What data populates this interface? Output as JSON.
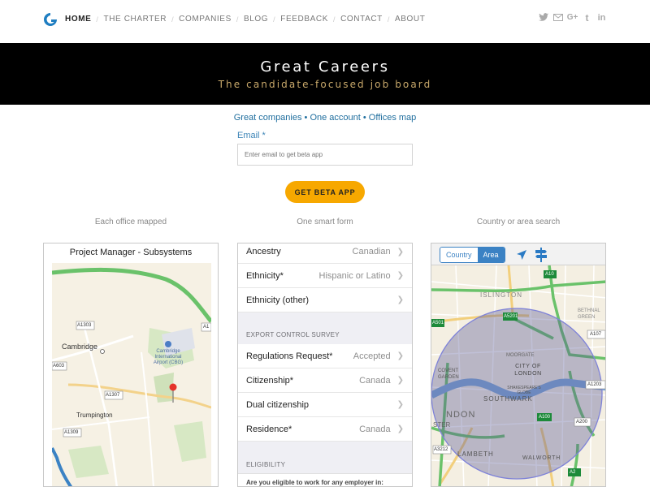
{
  "nav": {
    "items": [
      "HOME",
      "THE CHARTER",
      "COMPANIES",
      "BLOG",
      "FEEDBACK",
      "CONTACT",
      "ABOUT"
    ],
    "active": "HOME",
    "social_icons": [
      "twitter-icon",
      "mail-icon",
      "google-plus-icon",
      "tumblr-icon",
      "linkedin-icon"
    ]
  },
  "hero": {
    "title": "Great Careers",
    "subtitle": "The candidate-focused job board"
  },
  "signup": {
    "tagline": "Great companies • One account • Offices map",
    "email_label": "Email *",
    "email_placeholder": "Enter email to get beta app",
    "button_label": "GET BETA APP"
  },
  "features": [
    {
      "label": "Each office mapped"
    },
    {
      "label": "One smart form"
    },
    {
      "label": "Country or area search"
    }
  ],
  "panel_map": {
    "title": "Project Manager - Subsystems",
    "labels": {
      "cambridge": "Cambridge",
      "airport": "Cambridge International Airport (CBG)",
      "trumpington": "Trumpington",
      "roads": [
        "A1303",
        "A603",
        "A1307",
        "A1309",
        "A1"
      ]
    }
  },
  "panel_form": {
    "rows_top": [
      {
        "label": "Ancestry",
        "value": "Canadian"
      },
      {
        "label": "Ethnicity*",
        "value": "Hispanic or Latino"
      },
      {
        "label": "Ethnicity (other)",
        "value": ""
      }
    ],
    "section1": "EXPORT CONTROL SURVEY",
    "rows_mid": [
      {
        "label": "Regulations Request*",
        "value": "Accepted"
      },
      {
        "label": "Citizenship*",
        "value": "Canada"
      },
      {
        "label": "Dual citizenship",
        "value": ""
      },
      {
        "label": "Residence*",
        "value": "Canada"
      }
    ],
    "section2": "ELIGIBILITY",
    "question": "Are you eligible to work for any employer in:"
  },
  "panel_search": {
    "seg_country": "Country",
    "seg_area": "Area",
    "active_seg": "Area",
    "labels": {
      "islington": "ISLINGTON",
      "city": "CITY OF LONDON",
      "southwark": "SOUTHWARK",
      "walworth": "WALWORTH",
      "lambeth": "LAMBETH",
      "moorgate": "MOORGATE",
      "covent": "COVENT GARDEN",
      "bethnal": "BETHNAL GREEN",
      "london_partial": "NDON",
      "ster_partial": "STER",
      "globe": "SHAKESPEARE'S GLOBE",
      "roads": [
        "A10",
        "A501",
        "A5201",
        "A107",
        "A1203",
        "A100",
        "A200",
        "A3212",
        "A2"
      ]
    }
  },
  "colors": {
    "accent": "#f7a800",
    "link": "#1f6e9e",
    "hero_bg": "#000000",
    "hero_sub": "#c9a96b",
    "segment": "#3b82c4",
    "road_green": "#6ac26a"
  }
}
